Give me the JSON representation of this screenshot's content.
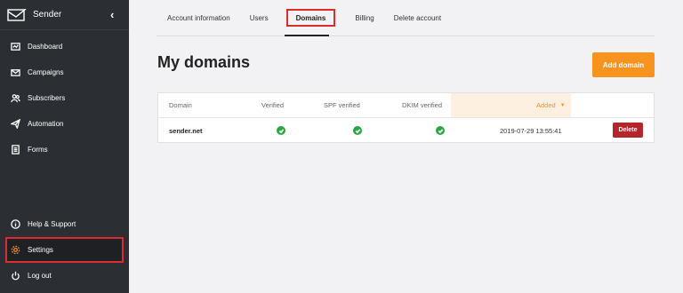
{
  "brand": {
    "name": "Sender"
  },
  "sidebar": {
    "items": [
      {
        "label": "Dashboard",
        "icon": "dashboard-icon"
      },
      {
        "label": "Campaigns",
        "icon": "envelope-icon"
      },
      {
        "label": "Subscribers",
        "icon": "users-icon"
      },
      {
        "label": "Automation",
        "icon": "paper-plane-icon"
      },
      {
        "label": "Forms",
        "icon": "form-icon"
      }
    ],
    "bottom_items": [
      {
        "label": "Help & Support",
        "icon": "info-icon"
      },
      {
        "label": "Settings",
        "icon": "gear-icon",
        "active": true
      },
      {
        "label": "Log out",
        "icon": "power-icon"
      }
    ]
  },
  "tabs": [
    {
      "label": "Account information"
    },
    {
      "label": "Users"
    },
    {
      "label": "Domains",
      "active": true
    },
    {
      "label": "Billing"
    },
    {
      "label": "Delete account"
    }
  ],
  "page": {
    "title": "My domains",
    "add_button": "Add domain"
  },
  "table": {
    "columns": [
      "Domain",
      "Verified",
      "SPF verified",
      "DKIM verified",
      "Added"
    ],
    "sorted_column": "Added",
    "rows": [
      {
        "domain": "sender.net",
        "verified": true,
        "spf": true,
        "dkim": true,
        "added": "2019-07-29 13:55:41",
        "delete_label": "Delete"
      }
    ]
  },
  "colors": {
    "accent": "#f7931e",
    "sidebar": "#2b2e33",
    "success": "#28a745",
    "danger": "#b3262a",
    "highlight": "#d92c2c"
  }
}
